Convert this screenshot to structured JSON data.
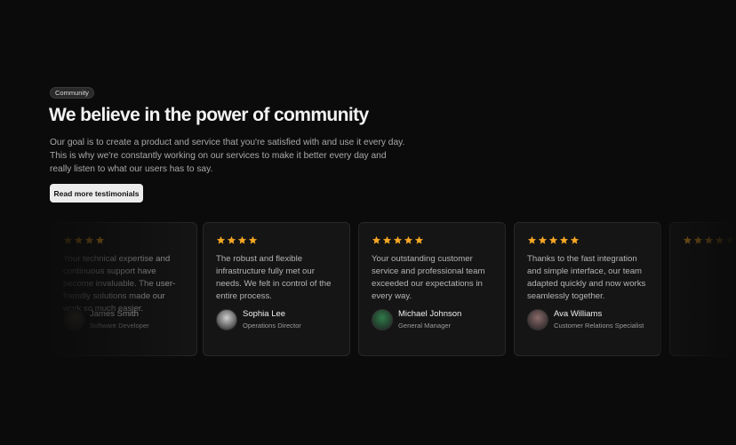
{
  "section": {
    "badge": "Community",
    "title": "We believe in the power of community",
    "description": "Our goal is to create a product and service that you're satisfied with and use it every day. This is why we're constantly working on our services to make it better every day and really listen to what our users has to say.",
    "cta_label": "Read more testimonials"
  },
  "colors": {
    "star": "#f5a623",
    "background": "#0b0b0b",
    "card": "#151515"
  },
  "testimonials": [
    {
      "rating": 4,
      "quote": "Your technical expertise and continuous support have become invaluable. The user-friendly solutions made our work so much easier.",
      "name": "James Smith",
      "role": "Software Developer",
      "avatar_color": "#6b5a4a"
    },
    {
      "rating": 4,
      "quote": "The robust and flexible infrastructure fully met our needs. We felt in control of the entire process.",
      "name": "Sophia Lee",
      "role": "Operations Director",
      "avatar_color": "#cfcfcf"
    },
    {
      "rating": 5,
      "quote": "Your outstanding customer service and professional team exceeded our expectations in every way.",
      "name": "Michael Johnson",
      "role": "General Manager",
      "avatar_color": "#2f7a4a"
    },
    {
      "rating": 5,
      "quote": "Thanks to the fast integration and simple interface, our team adapted quickly and now works seamlessly together.",
      "name": "Ava Williams",
      "role": "Customer Relations Specialist",
      "avatar_color": "#8a6a6a"
    }
  ]
}
